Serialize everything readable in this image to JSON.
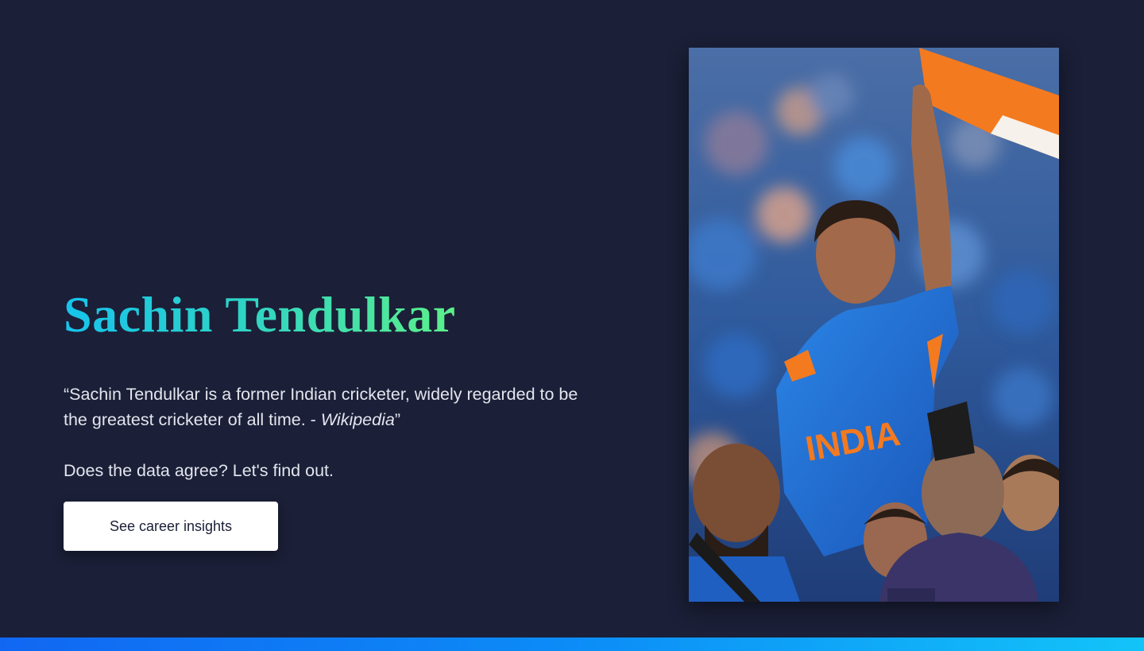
{
  "hero": {
    "title": "Sachin Tendulkar",
    "quote_open": "“",
    "quote_text": "Sachin Tendulkar is a former Indian cricketer, widely regarded to be the greatest cricketer of all time. - ",
    "quote_source": "Wikipedia",
    "quote_close": "”",
    "prompt": "Does the data agree? Let's find out.",
    "button_label": "See career insights"
  },
  "photo": {
    "jersey_text": "INDIA",
    "colors": {
      "jersey": "#1f6fd6",
      "flag_orange": "#f47a1f",
      "background_blur": "#3a5fa8"
    }
  },
  "colors": {
    "background": "#1b1f37",
    "title_gradient_start": "#17c3ec",
    "title_gradient_end": "#5cf08a",
    "bottom_bar_start": "#1167f2",
    "bottom_bar_end": "#12c4f8"
  }
}
